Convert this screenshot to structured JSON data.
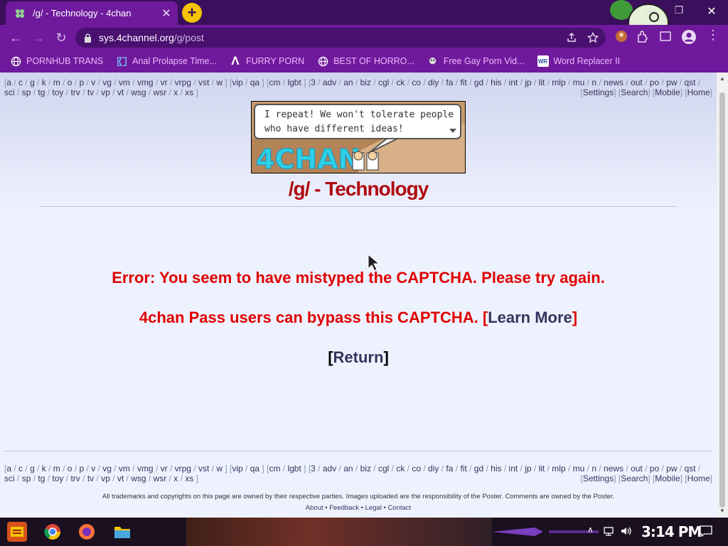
{
  "browser": {
    "tab_title": "/g/ - Technology - 4chan",
    "tab_close": "✕",
    "new_tab": "+",
    "url_host": "sys.4channel.org",
    "url_path": "/g/post",
    "window_minimize": "—",
    "window_restore": "❐",
    "window_close": "✕",
    "accent_color": "#6f1a9c"
  },
  "bookmarks": [
    {
      "label": "PORNHUB TRANS",
      "icon": "globe-icon"
    },
    {
      "label": "Anal Prolapse Time...",
      "icon": "bracket-icon"
    },
    {
      "label": "FURRY PORN",
      "icon": "lambda-icon"
    },
    {
      "label": "BEST OF HORRO...",
      "icon": "globe-icon"
    },
    {
      "label": "Free Gay Porn Vid...",
      "icon": "mascot-icon"
    },
    {
      "label": "Word Replacer II",
      "icon": "wr-icon"
    }
  ],
  "board_nav": {
    "groups": [
      [
        "a",
        "c",
        "g",
        "k",
        "m",
        "o",
        "p",
        "v",
        "vg",
        "vm",
        "vmg",
        "vr",
        "vrpg",
        "vst",
        "w"
      ],
      [
        "vip",
        "qa"
      ],
      [
        "cm",
        "lgbt"
      ],
      [
        "3",
        "adv",
        "an",
        "biz",
        "cgl",
        "ck",
        "co",
        "diy",
        "fa",
        "fit",
        "gd",
        "his",
        "int",
        "jp",
        "lit",
        "mlp",
        "mu",
        "n",
        "news",
        "out",
        "po",
        "pw",
        "qst",
        "sci",
        "sp",
        "tg",
        "toy",
        "trv",
        "tv",
        "vp",
        "vt",
        "wsg",
        "wsr",
        "x",
        "xs"
      ]
    ],
    "right_links": [
      "Settings",
      "Search",
      "Mobile",
      "Home"
    ]
  },
  "banner": {
    "speech": [
      "I repeat! We won't tolerate people",
      "who have different ideas!"
    ],
    "logo": "4CHAN"
  },
  "board_title": "/g/ - Technology",
  "error": {
    "message": "Error: You seem to have mistyped the CAPTCHA. Please try again.",
    "pass_text": "4chan Pass users can bypass this CAPTCHA.",
    "learn_more": "Learn More",
    "return": "Return"
  },
  "footer": {
    "disclaimer": "All trademarks and copyrights on this page are owned by their respective parties. Images uploaded are the responsibility of the Poster. Comments are owned by the Poster.",
    "links": [
      "About",
      "Feedback",
      "Legal",
      "Contact"
    ]
  },
  "taskbar": {
    "clock": "3:14 PM"
  }
}
